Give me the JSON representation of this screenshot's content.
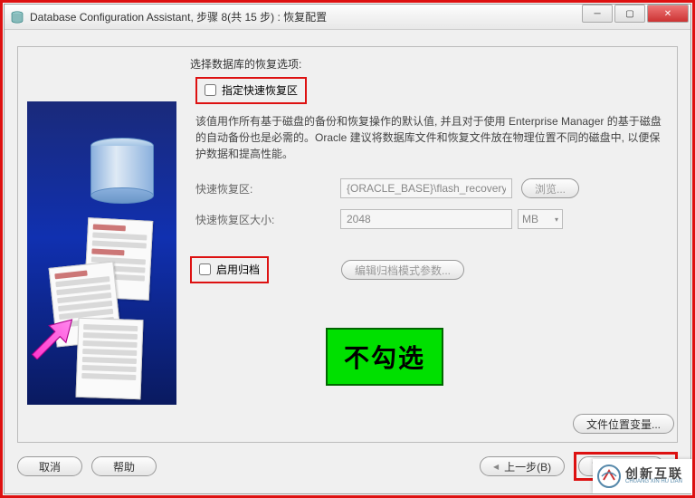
{
  "window": {
    "title": "Database Configuration Assistant, 步骤 8(共 15 步) : 恢复配置"
  },
  "content": {
    "section_title": "选择数据库的恢复选项:",
    "fast_recovery_checkbox": "指定快速恢复区",
    "description": "该值用作所有基于磁盘的备份和恢复操作的默认值, 并且对于使用 Enterprise Manager 的基于磁盘的自动备份也是必需的。Oracle 建议将数据库文件和恢复文件放在物理位置不同的磁盘中, 以便保护数据和提高性能。",
    "fast_recovery_area_label": "快速恢复区:",
    "fast_recovery_area_value": "{ORACLE_BASE}\\flash_recovery_area",
    "browse_button": "浏览...",
    "fast_recovery_size_label": "快速恢复区大小:",
    "fast_recovery_size_value": "2048",
    "size_unit": "MB",
    "archive_checkbox": "启用归档",
    "archive_params_button": "编辑归档模式参数...",
    "file_location_button": "文件位置变量..."
  },
  "annotation": {
    "green_box": "不勾选"
  },
  "buttons": {
    "cancel": "取消",
    "help": "帮助",
    "back": "上一步(B)",
    "next": "下一步(N)"
  },
  "watermark": {
    "brand": "创新互联",
    "sub": "CHUANG XIN HU LIAN"
  }
}
